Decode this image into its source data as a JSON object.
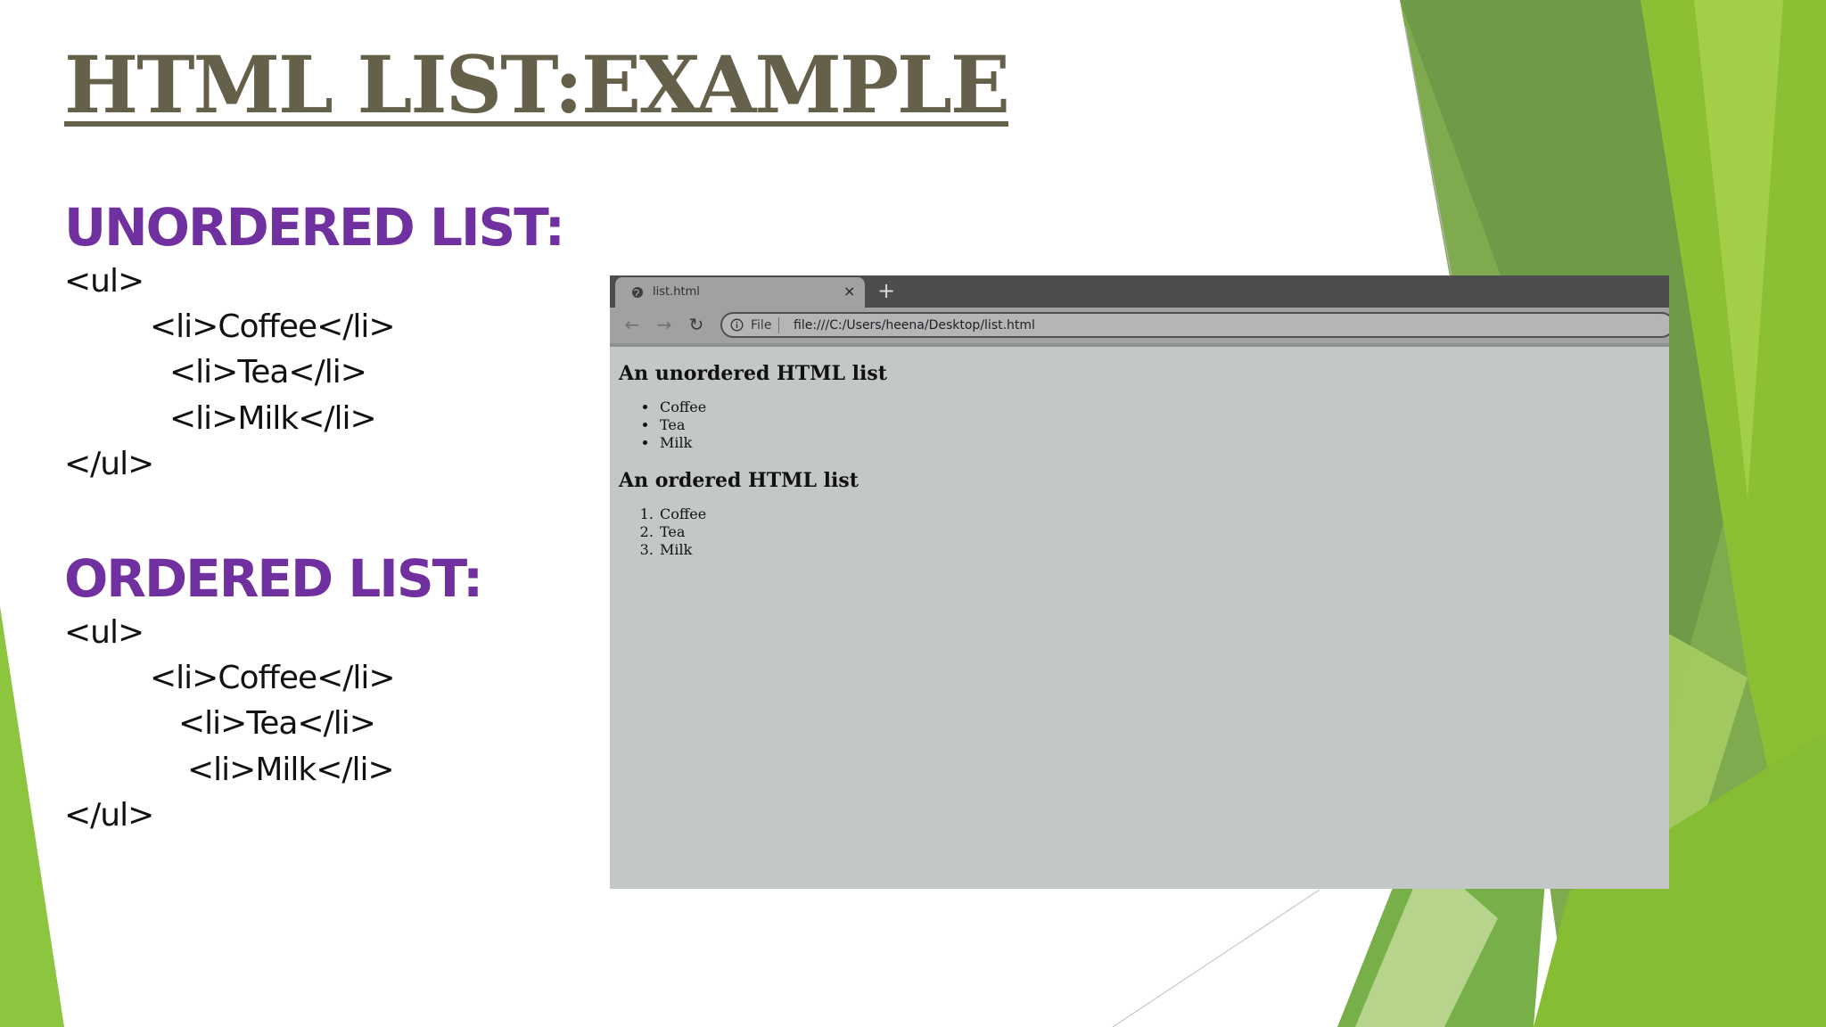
{
  "slide": {
    "title": "HTML LIST:EXAMPLE",
    "unordered_heading": "UNORDERED LIST:",
    "ordered_heading": "ORDERED LIST:",
    "unordered_code": [
      "<ul>",
      "<li>Coffee</li>",
      "<li>Tea</li>",
      "<li>Milk</li>",
      "</ul>"
    ],
    "ordered_code": [
      "<ul>",
      "<li>Coffee</li>",
      "<li>Tea</li>",
      "<li>Milk</li>",
      "</ul>"
    ]
  },
  "browser": {
    "tab_title": "list.html",
    "tab_close": "×",
    "new_tab": "+",
    "back_icon": "←",
    "forward_icon": "→",
    "reload_icon": "↻",
    "scheme_label": "File",
    "url": "file:///C:/Users/heena/Desktop/list.html",
    "page": {
      "unordered_heading": "An unordered HTML list",
      "unordered_items": [
        "Coffee",
        "Tea",
        "Milk"
      ],
      "ordered_heading": "An ordered HTML list",
      "ordered_items": [
        "Coffee",
        "Tea",
        "Milk"
      ]
    }
  },
  "colors": {
    "title": "#65604a",
    "heading": "#7030a0",
    "green_light": "#9bc53d",
    "green_dark": "#5a8f2e"
  }
}
